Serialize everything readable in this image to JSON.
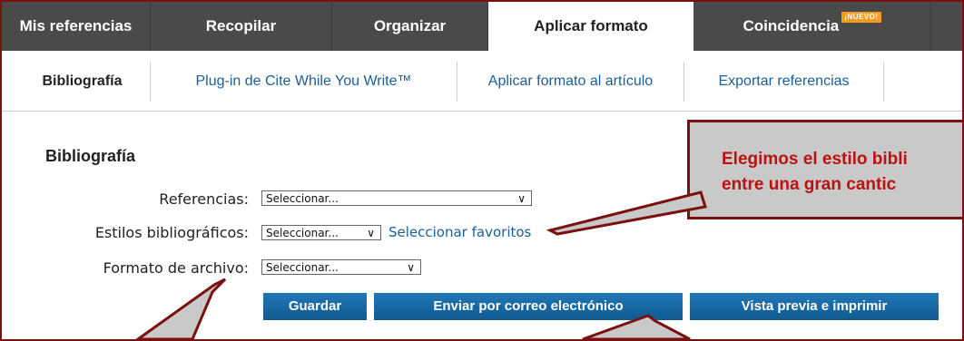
{
  "topnav": {
    "tabs": [
      {
        "label": "Mis referencias"
      },
      {
        "label": "Recopilar"
      },
      {
        "label": "Organizar"
      },
      {
        "label": "Aplicar formato"
      },
      {
        "label": "Coincidencia",
        "badge": "¡NUEVO!"
      }
    ]
  },
  "subnav": {
    "items": [
      {
        "label": "Bibliografía"
      },
      {
        "label": "Plug-in de Cite While You Write™"
      },
      {
        "label": "Aplicar formato al artículo"
      },
      {
        "label": "Exportar referencias"
      }
    ]
  },
  "main": {
    "heading": "Bibliografía",
    "fields": [
      {
        "label": "Referencias:",
        "value": "Seleccionar..."
      },
      {
        "label": "Estilos bibliográficos:",
        "value": "Seleccionar..."
      },
      {
        "label": "Formato de archivo:",
        "value": "Seleccionar..."
      }
    ],
    "favorites_link": "Seleccionar favoritos",
    "buttons": {
      "save": "Guardar",
      "email": "Enviar por correo electrónico",
      "preview": "Vista previa e imprimir"
    }
  },
  "callout": {
    "line1": "Elegimos el estilo bibli",
    "line2": "entre una gran cantic"
  },
  "colors": {
    "nav_bg": "#4a4a4a",
    "link": "#1a5f99",
    "button": "#1565a0",
    "callout_text": "#bb1111",
    "border": "#7a1010"
  }
}
